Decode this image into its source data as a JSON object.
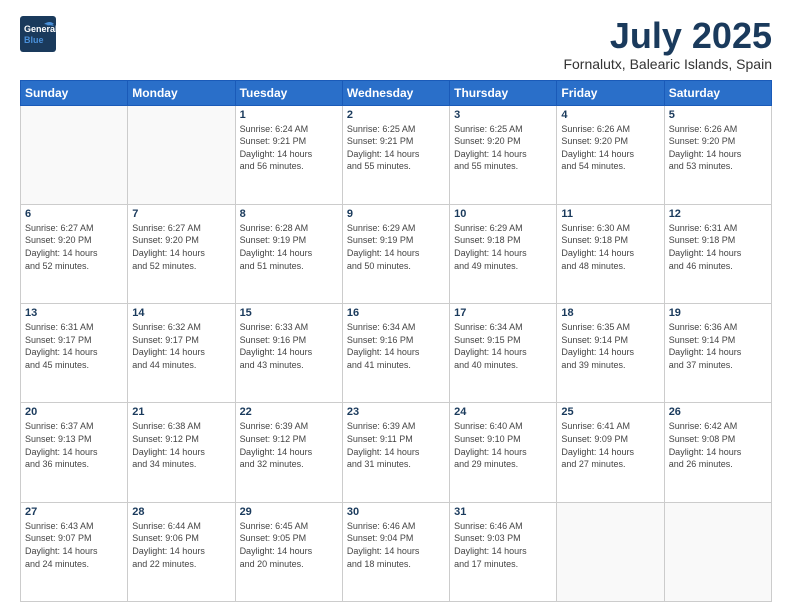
{
  "header": {
    "logo_line1": "General",
    "logo_line2": "Blue",
    "month": "July 2025",
    "location": "Fornalutx, Balearic Islands, Spain"
  },
  "weekdays": [
    "Sunday",
    "Monday",
    "Tuesday",
    "Wednesday",
    "Thursday",
    "Friday",
    "Saturday"
  ],
  "weeks": [
    [
      {
        "day": "",
        "info": ""
      },
      {
        "day": "",
        "info": ""
      },
      {
        "day": "1",
        "info": "Sunrise: 6:24 AM\nSunset: 9:21 PM\nDaylight: 14 hours\nand 56 minutes."
      },
      {
        "day": "2",
        "info": "Sunrise: 6:25 AM\nSunset: 9:21 PM\nDaylight: 14 hours\nand 55 minutes."
      },
      {
        "day": "3",
        "info": "Sunrise: 6:25 AM\nSunset: 9:20 PM\nDaylight: 14 hours\nand 55 minutes."
      },
      {
        "day": "4",
        "info": "Sunrise: 6:26 AM\nSunset: 9:20 PM\nDaylight: 14 hours\nand 54 minutes."
      },
      {
        "day": "5",
        "info": "Sunrise: 6:26 AM\nSunset: 9:20 PM\nDaylight: 14 hours\nand 53 minutes."
      }
    ],
    [
      {
        "day": "6",
        "info": "Sunrise: 6:27 AM\nSunset: 9:20 PM\nDaylight: 14 hours\nand 52 minutes."
      },
      {
        "day": "7",
        "info": "Sunrise: 6:27 AM\nSunset: 9:20 PM\nDaylight: 14 hours\nand 52 minutes."
      },
      {
        "day": "8",
        "info": "Sunrise: 6:28 AM\nSunset: 9:19 PM\nDaylight: 14 hours\nand 51 minutes."
      },
      {
        "day": "9",
        "info": "Sunrise: 6:29 AM\nSunset: 9:19 PM\nDaylight: 14 hours\nand 50 minutes."
      },
      {
        "day": "10",
        "info": "Sunrise: 6:29 AM\nSunset: 9:18 PM\nDaylight: 14 hours\nand 49 minutes."
      },
      {
        "day": "11",
        "info": "Sunrise: 6:30 AM\nSunset: 9:18 PM\nDaylight: 14 hours\nand 48 minutes."
      },
      {
        "day": "12",
        "info": "Sunrise: 6:31 AM\nSunset: 9:18 PM\nDaylight: 14 hours\nand 46 minutes."
      }
    ],
    [
      {
        "day": "13",
        "info": "Sunrise: 6:31 AM\nSunset: 9:17 PM\nDaylight: 14 hours\nand 45 minutes."
      },
      {
        "day": "14",
        "info": "Sunrise: 6:32 AM\nSunset: 9:17 PM\nDaylight: 14 hours\nand 44 minutes."
      },
      {
        "day": "15",
        "info": "Sunrise: 6:33 AM\nSunset: 9:16 PM\nDaylight: 14 hours\nand 43 minutes."
      },
      {
        "day": "16",
        "info": "Sunrise: 6:34 AM\nSunset: 9:16 PM\nDaylight: 14 hours\nand 41 minutes."
      },
      {
        "day": "17",
        "info": "Sunrise: 6:34 AM\nSunset: 9:15 PM\nDaylight: 14 hours\nand 40 minutes."
      },
      {
        "day": "18",
        "info": "Sunrise: 6:35 AM\nSunset: 9:14 PM\nDaylight: 14 hours\nand 39 minutes."
      },
      {
        "day": "19",
        "info": "Sunrise: 6:36 AM\nSunset: 9:14 PM\nDaylight: 14 hours\nand 37 minutes."
      }
    ],
    [
      {
        "day": "20",
        "info": "Sunrise: 6:37 AM\nSunset: 9:13 PM\nDaylight: 14 hours\nand 36 minutes."
      },
      {
        "day": "21",
        "info": "Sunrise: 6:38 AM\nSunset: 9:12 PM\nDaylight: 14 hours\nand 34 minutes."
      },
      {
        "day": "22",
        "info": "Sunrise: 6:39 AM\nSunset: 9:12 PM\nDaylight: 14 hours\nand 32 minutes."
      },
      {
        "day": "23",
        "info": "Sunrise: 6:39 AM\nSunset: 9:11 PM\nDaylight: 14 hours\nand 31 minutes."
      },
      {
        "day": "24",
        "info": "Sunrise: 6:40 AM\nSunset: 9:10 PM\nDaylight: 14 hours\nand 29 minutes."
      },
      {
        "day": "25",
        "info": "Sunrise: 6:41 AM\nSunset: 9:09 PM\nDaylight: 14 hours\nand 27 minutes."
      },
      {
        "day": "26",
        "info": "Sunrise: 6:42 AM\nSunset: 9:08 PM\nDaylight: 14 hours\nand 26 minutes."
      }
    ],
    [
      {
        "day": "27",
        "info": "Sunrise: 6:43 AM\nSunset: 9:07 PM\nDaylight: 14 hours\nand 24 minutes."
      },
      {
        "day": "28",
        "info": "Sunrise: 6:44 AM\nSunset: 9:06 PM\nDaylight: 14 hours\nand 22 minutes."
      },
      {
        "day": "29",
        "info": "Sunrise: 6:45 AM\nSunset: 9:05 PM\nDaylight: 14 hours\nand 20 minutes."
      },
      {
        "day": "30",
        "info": "Sunrise: 6:46 AM\nSunset: 9:04 PM\nDaylight: 14 hours\nand 18 minutes."
      },
      {
        "day": "31",
        "info": "Sunrise: 6:46 AM\nSunset: 9:03 PM\nDaylight: 14 hours\nand 17 minutes."
      },
      {
        "day": "",
        "info": ""
      },
      {
        "day": "",
        "info": ""
      }
    ]
  ]
}
